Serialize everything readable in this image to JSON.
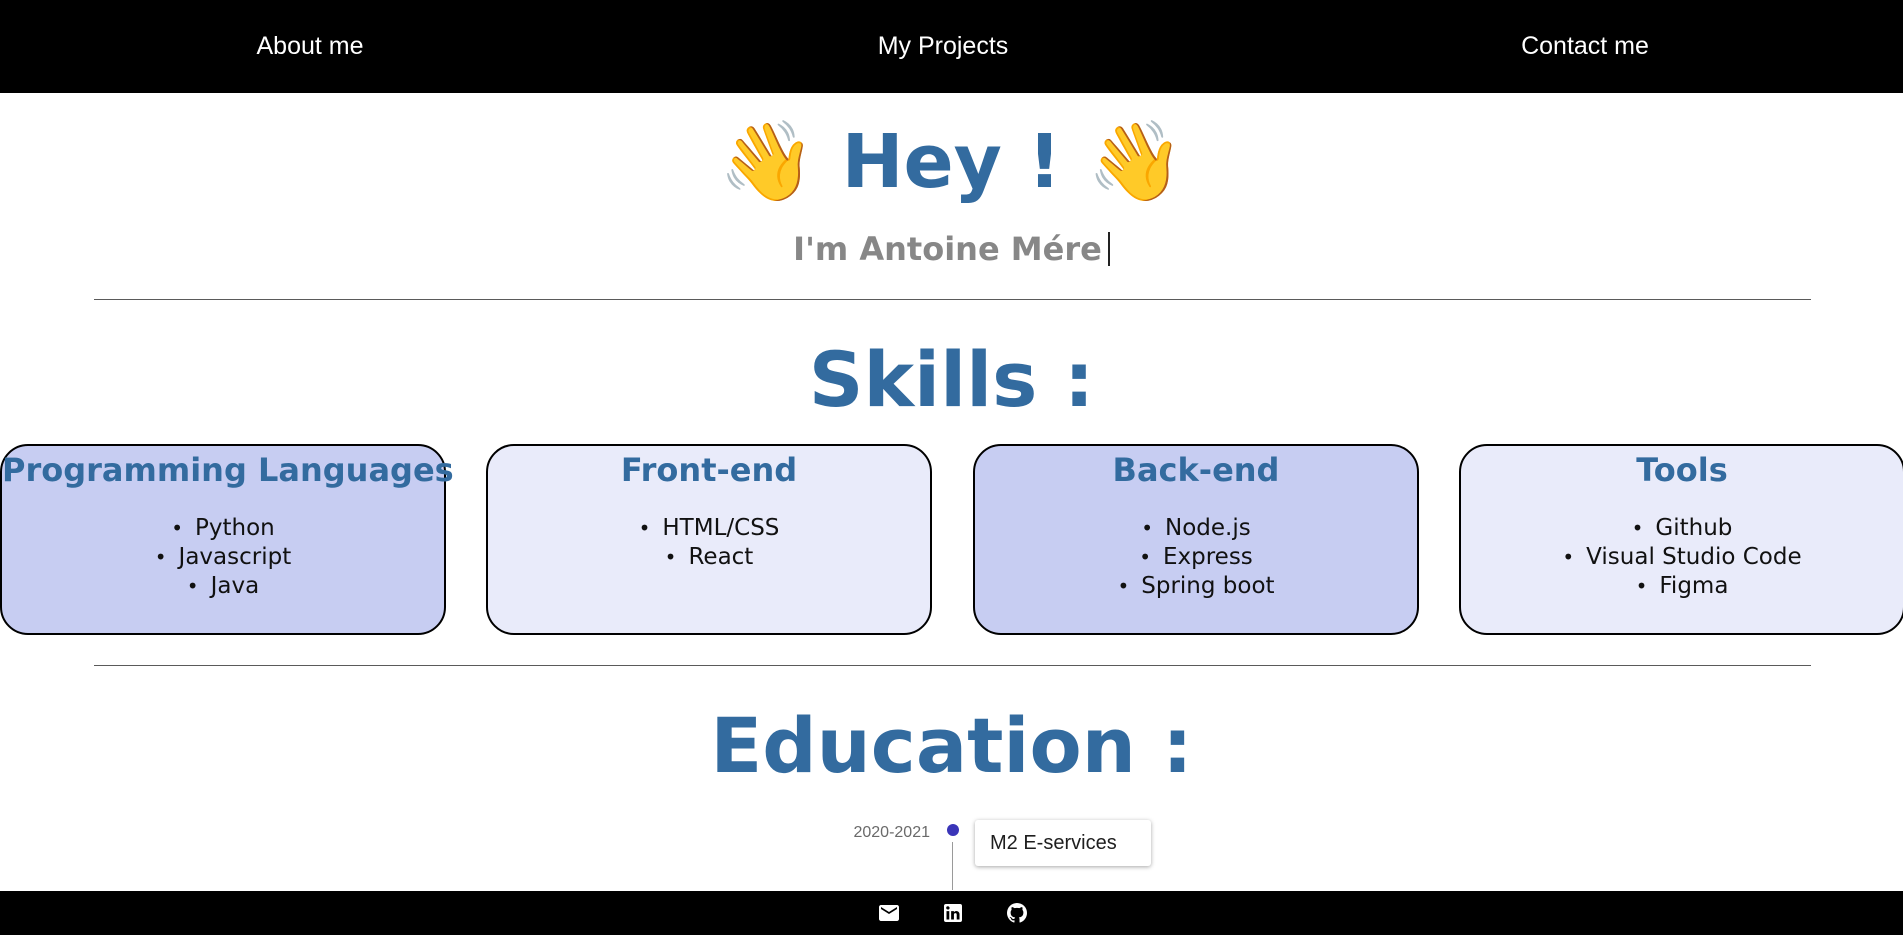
{
  "nav": {
    "items": [
      {
        "label": "About me"
      },
      {
        "label": "My Projects"
      },
      {
        "label": "Contact me"
      }
    ]
  },
  "hero": {
    "title": "Hey !",
    "wave_emoji": "👋",
    "subtitle": "I'm Antoine Mére"
  },
  "skills": {
    "title": "Skills :",
    "cards": [
      {
        "title": "Programming Languages",
        "items": [
          "Python",
          "Javascript",
          "Java"
        ]
      },
      {
        "title": "Front-end",
        "items": [
          "HTML/CSS",
          "React"
        ]
      },
      {
        "title": "Back-end",
        "items": [
          "Node.js",
          "Express",
          "Spring boot"
        ]
      },
      {
        "title": "Tools",
        "items": [
          "Github",
          "Visual Studio Code",
          "Figma"
        ]
      }
    ]
  },
  "education": {
    "title": "Education :",
    "timeline": [
      {
        "date": "2020-2021",
        "label": "M2 E-services"
      }
    ]
  },
  "footer": {
    "icons": [
      "mail-icon",
      "linkedin-icon",
      "github-icon"
    ]
  },
  "colors": {
    "accent": "#336b9f",
    "card_dark": "#c7cdf2",
    "card_light": "#e9ebfa",
    "timeline_dot": "#3a35b8"
  }
}
